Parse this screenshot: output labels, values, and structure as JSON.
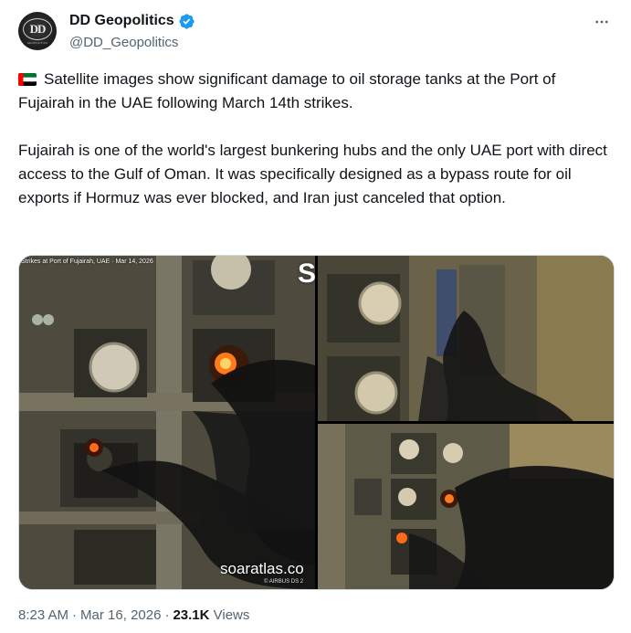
{
  "author": {
    "display_name": "DD Geopolitics",
    "handle": "@DD_Geopolitics",
    "avatar_monogram": "DD",
    "avatar_subtext": "GEOPOLITICS",
    "verified": true,
    "verified_color": "#1d9bf0"
  },
  "more_icon": "more-horizontal-icon",
  "tweet": {
    "paragraph_1": "Satellite images show significant damage to oil storage tanks at the Port of Fujairah in the UAE following March 14th strikes.",
    "paragraph_2": "Fujairah is one of the world's largest bunkering hubs and the only UAE port with direct access to the Gulf of Oman. It was specifically designed as a bypass route for oil exports if Hormuz was ever blocked, and Iran just canceled that option.",
    "flag_icon": "uae-flag-icon"
  },
  "media": {
    "image_1_caption": "Strikes at Port of Fujairah, UAE · Mar 14, 2026",
    "image_1_watermark": "soaratlas.co",
    "image_1_watermark_sub": "© AIRBUS DS 2",
    "image_1_corner_mark": "S"
  },
  "footer": {
    "time": "8:23 AM",
    "date": "Mar 16, 2026",
    "views_count": "23.1K",
    "views_label": "Views",
    "separator": "·"
  },
  "colors": {
    "text_primary": "#0f1419",
    "text_secondary": "#536471",
    "border": "#cfd9de",
    "accent": "#1d9bf0"
  }
}
